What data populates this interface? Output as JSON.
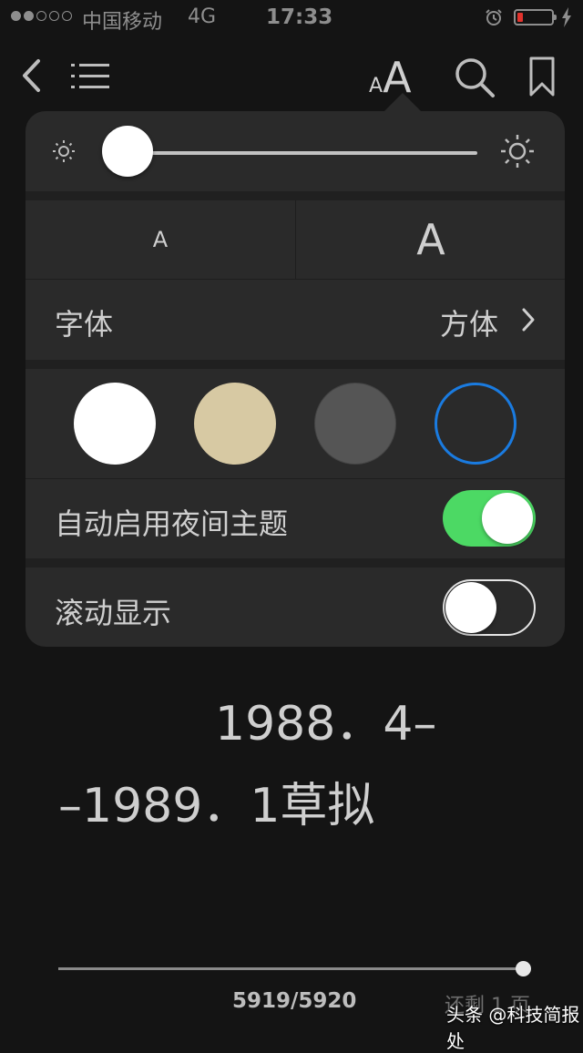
{
  "status_bar": {
    "carrier": "中国移动",
    "network": "4G",
    "time": "17:33",
    "signal_bars_filled": 2,
    "signal_bars_total": 5,
    "battery_level": 0.12,
    "battery_color": "#e2332d"
  },
  "toolbar": {
    "icons": [
      "back-icon",
      "table-of-contents-icon",
      "font-size-icon",
      "search-icon",
      "bookmark-icon"
    ],
    "font_small_glyph": "A",
    "font_big_glyph": "A"
  },
  "settings": {
    "brightness": 0.0,
    "font_size_small": "A",
    "font_size_large": "A",
    "font_label": "字体",
    "font_value": "方体",
    "themes": [
      {
        "name": "white",
        "color": "#ffffff",
        "selected": false
      },
      {
        "name": "sepia",
        "color": "#d7c9a3",
        "selected": false
      },
      {
        "name": "gray",
        "color": "#555555",
        "selected": false
      },
      {
        "name": "night",
        "color": "#2a2a2a",
        "selected": true
      }
    ],
    "accent_color": "#1a7be0",
    "auto_night_label": "自动启用夜间主题",
    "auto_night_on": true,
    "toggle_on_color": "#4cd964",
    "scroll_label": "滚动显示",
    "scroll_on": false
  },
  "page": {
    "line1": "1988．4–",
    "line2": "–1989．1草拟",
    "page_indicator": "5919/5920",
    "remaining": "还剩 1 页",
    "progress": 0.998
  },
  "watermark": "头条 @科技简报处"
}
